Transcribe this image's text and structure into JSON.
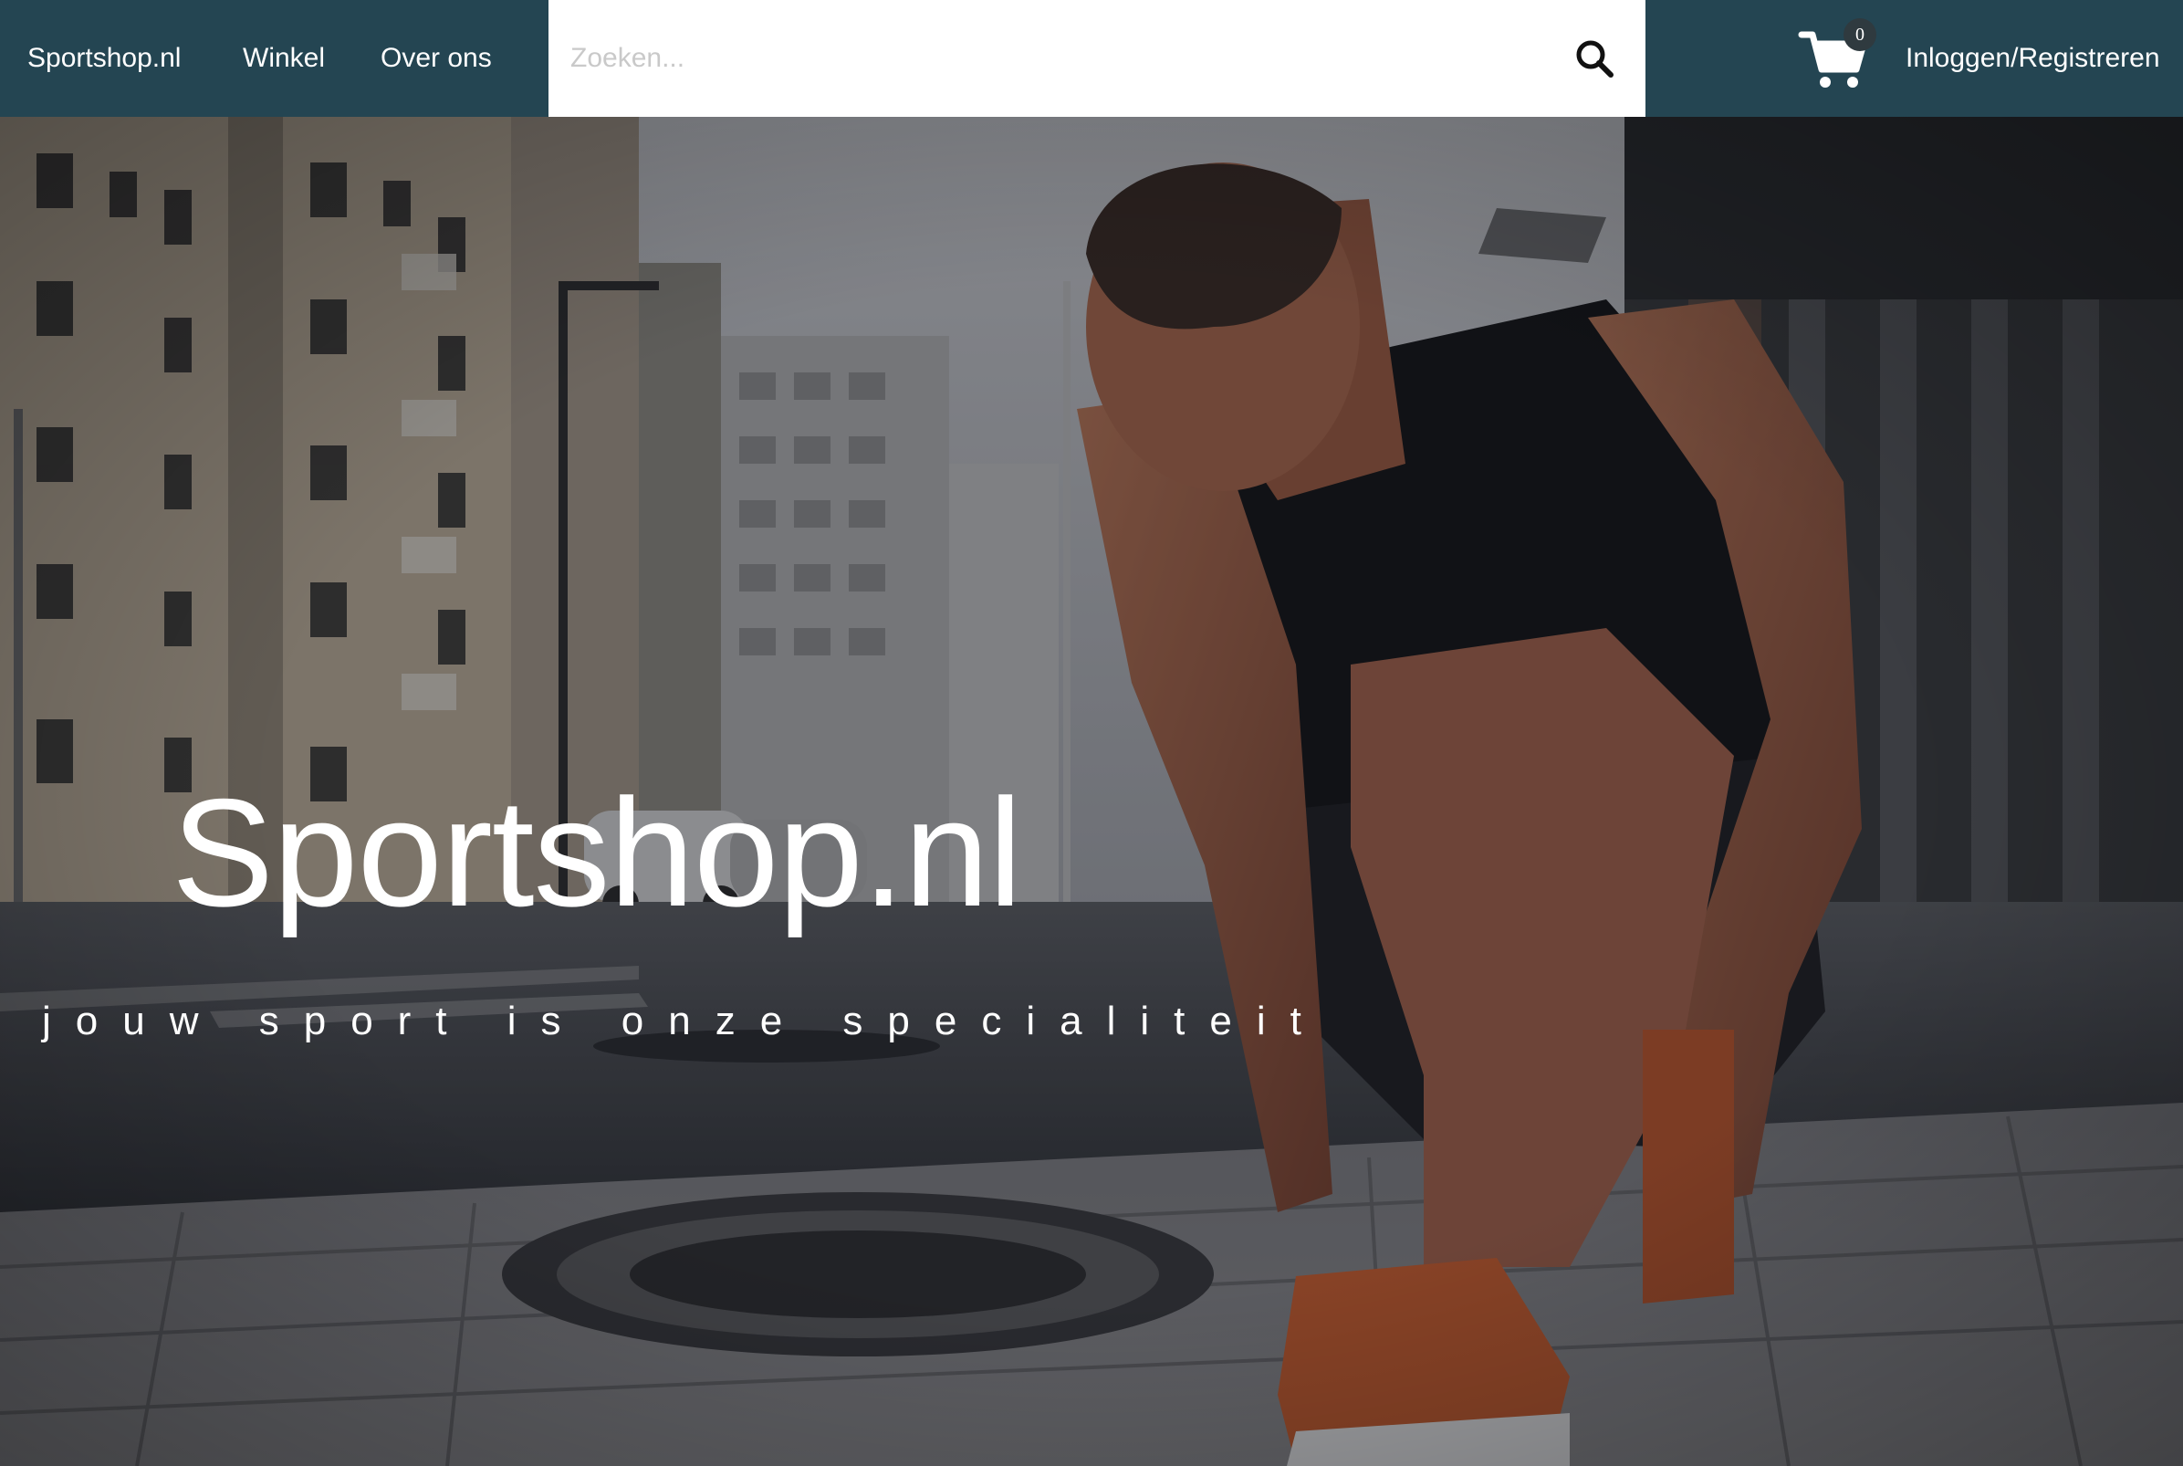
{
  "nav": {
    "brand": "Sportshop.nl",
    "links": [
      {
        "label": "Winkel"
      },
      {
        "label": "Over ons"
      }
    ],
    "search_placeholder": "Zoeken...",
    "cart_count": "0",
    "login_label": "Inloggen/Registreren"
  },
  "hero": {
    "title": "Sportshop.nl",
    "tagline": "jouw sport is onze specialiteit"
  },
  "icons": {
    "search": "search-icon",
    "cart": "shopping-cart-icon"
  },
  "colors": {
    "navbar": "#244552",
    "text": "#ffffff"
  }
}
